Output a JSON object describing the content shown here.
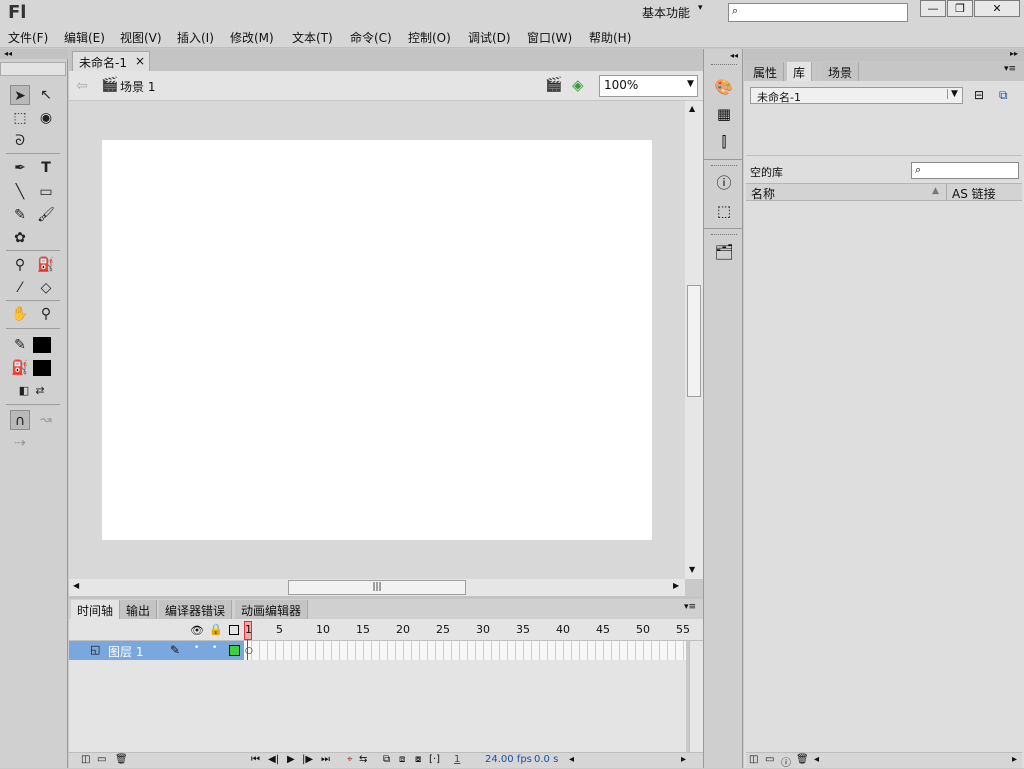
{
  "app": {
    "logo": "Fl",
    "workspace": "基本功能",
    "workspace_arrow": "▾"
  },
  "window_buttons": {
    "minimize": "—",
    "restore": "❐",
    "close": "✕"
  },
  "menus": [
    "文件(F)",
    "编辑(E)",
    "视图(V)",
    "插入(I)",
    "修改(M)",
    "文本(T)",
    "命令(C)",
    "控制(O)",
    "调试(D)",
    "窗口(W)",
    "帮助(H)"
  ],
  "document": {
    "tab_title": "未命名-1",
    "tab_close": "×",
    "scene_label": "场景 1",
    "zoom": "100%"
  },
  "timeline": {
    "tabs": [
      "时间轴",
      "输出",
      "编译器错误",
      "动画编辑器"
    ],
    "frame_numbers": [
      "1",
      "5",
      "10",
      "15",
      "20",
      "25",
      "30",
      "35",
      "40",
      "45",
      "50",
      "55"
    ],
    "layer_name": "图层 1",
    "current_frame": "1",
    "fps": "24.00 fps",
    "elapsed": "0.0 s"
  },
  "right_panel": {
    "tabs": [
      "属性",
      "库",
      "场景"
    ],
    "library_document": "未命名-1",
    "empty_label": "空的库",
    "col_name": "名称",
    "col_linkage": "AS 链接"
  },
  "colors": {
    "stroke": "#000000",
    "fill": "#000000",
    "layer_selected": "#7aa7dd",
    "playhead": "#dd2222"
  }
}
